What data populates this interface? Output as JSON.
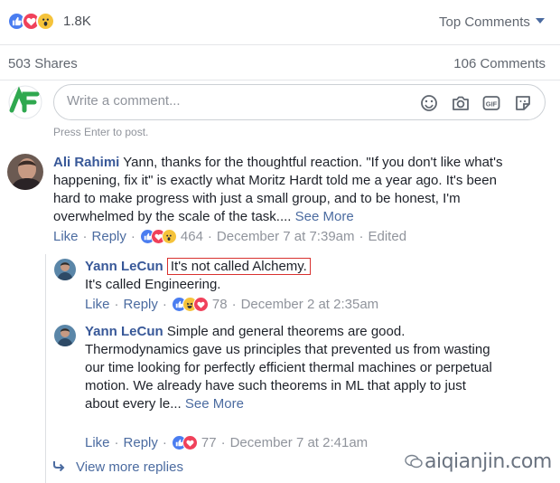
{
  "reactions_bar": {
    "count": "1.8K",
    "sort_label": "Top Comments"
  },
  "stats": {
    "shares": "503 Shares",
    "comments": "106 Comments"
  },
  "composer": {
    "placeholder": "Write a comment...",
    "hint": "Press Enter to post."
  },
  "comments": [
    {
      "author": "Ali Rahimi",
      "text": "Yann, thanks for the thoughtful reaction. \"If you don't like what's happening, fix it\" is exactly what Moritz Hardt told me a year ago. It's been hard to make progress with just a small group, and to be honest, I'm overwhelmed by the scale of the task....",
      "see_more": "See More",
      "like": "Like",
      "reply": "Reply",
      "reaction_count": "464",
      "timestamp": "December 7 at 7:39am",
      "edited": "Edited"
    }
  ],
  "replies": [
    {
      "author": "Yann LeCun",
      "text_highlight": "It's not called Alchemy.",
      "text": "It's called Engineering.",
      "like": "Like",
      "reply": "Reply",
      "reaction_count": "78",
      "timestamp": "December 2 at 2:35am"
    },
    {
      "author": "Yann LeCun",
      "text": "Simple and general theorems are good. Thermodynamics gave us principles that prevented us from wasting our time looking for perfectly efficient thermal machines or perpetual motion. We already have such theorems in ML that apply to just about every le...",
      "see_more": "See More",
      "like": "Like",
      "reply": "Reply",
      "reaction_count": "77",
      "timestamp": "December 7 at 2:41am"
    }
  ],
  "view_more": "View more replies",
  "watermark": "aiqianjin.com",
  "colors": {
    "link": "#4b6ba0",
    "name": "#385898",
    "meta": "#90949c",
    "like": "#4a7df0",
    "love": "#f0415a",
    "wow": "#f5c33b",
    "highlight_border": "#d8312f"
  }
}
